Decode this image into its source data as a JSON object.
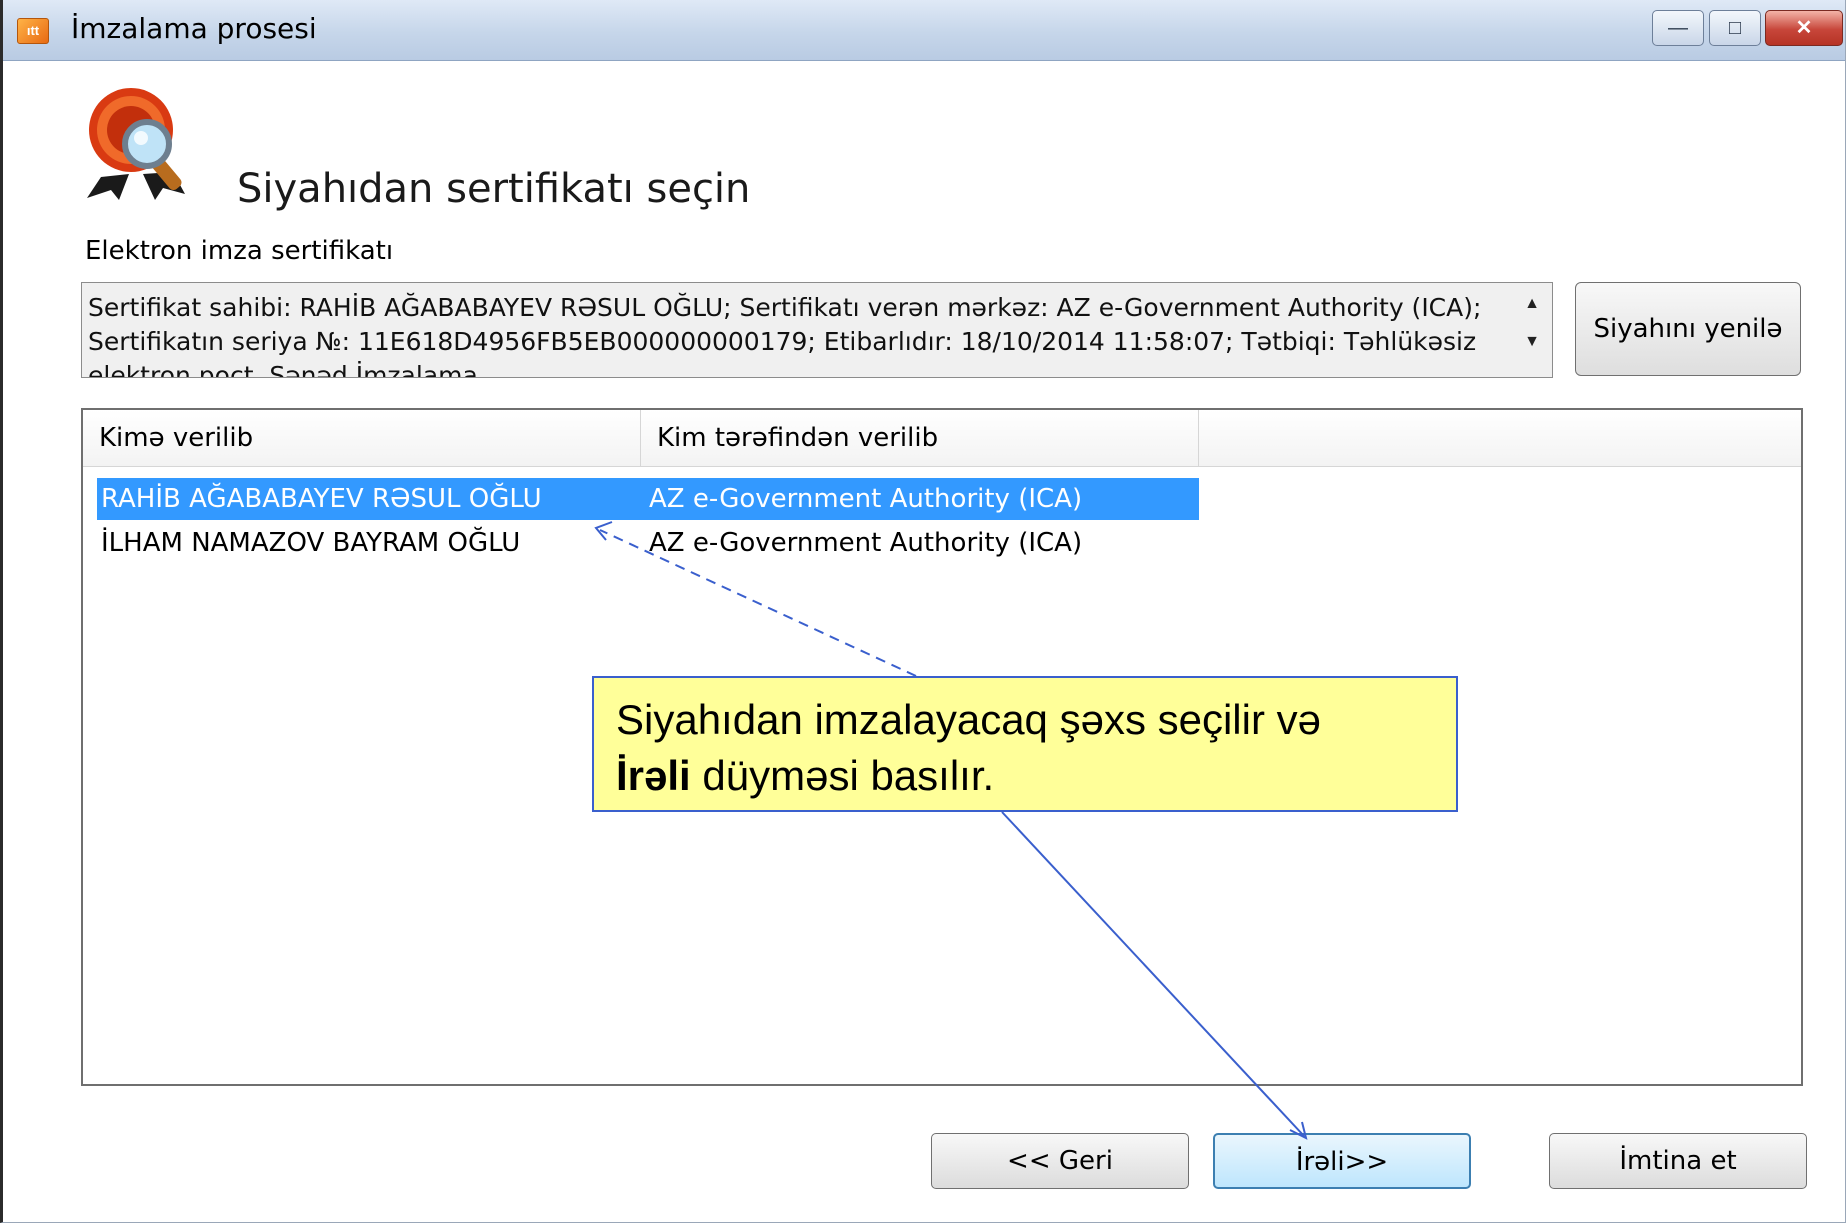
{
  "window": {
    "title": "İmzalama prosesi",
    "app_icon_label": "ıtt",
    "controls": {
      "minimize": "—",
      "maximize": "□",
      "close": "✕"
    }
  },
  "heading": "Siyahıdan sertifikatı seçin",
  "certificate": {
    "label": "Elektron imza sertifikatı",
    "details": "Sertifikat sahibi: RAHİB AĞABABAYEV RƏSUL OĞLU; Sertifikatı verən mərkəz: AZ e-Government Authority (ICA); Sertifikatın seriya №: 11E618D4956FB5EB000000000179; Etibarlıdır: 18/10/2014 11:58:07; Tətbiqi: Təhlükəsiz elektron poçt, Sənəd İmzalama",
    "scroll_up": "▲",
    "scroll_down": "▼",
    "refresh_button": "Siyahını yenilə"
  },
  "list": {
    "columns": [
      "Kimə verilib",
      "Kim tərəfindən verilib"
    ],
    "rows": [
      {
        "issued_to": "RAHİB AĞABABAYEV RƏSUL OĞLU",
        "issued_by": "AZ e-Government Authority (ICA)",
        "selected": true
      },
      {
        "issued_to": "İLHAM NAMAZOV BAYRAM OĞLU",
        "issued_by": "AZ e-Government Authority (ICA)",
        "selected": false
      }
    ]
  },
  "buttons": {
    "back": "<< Geri",
    "next": "İrəli>>",
    "cancel": "İmtina et"
  },
  "callout": {
    "line1": "Siyahıdan imzalayacaq şəxs seçilir  və",
    "bold": "İrəli",
    "line2_rest": " düyməsi basılır."
  },
  "colors": {
    "selection": "#3399ff",
    "callout_bg": "#ffff99",
    "callout_border": "#3a5fcd"
  }
}
